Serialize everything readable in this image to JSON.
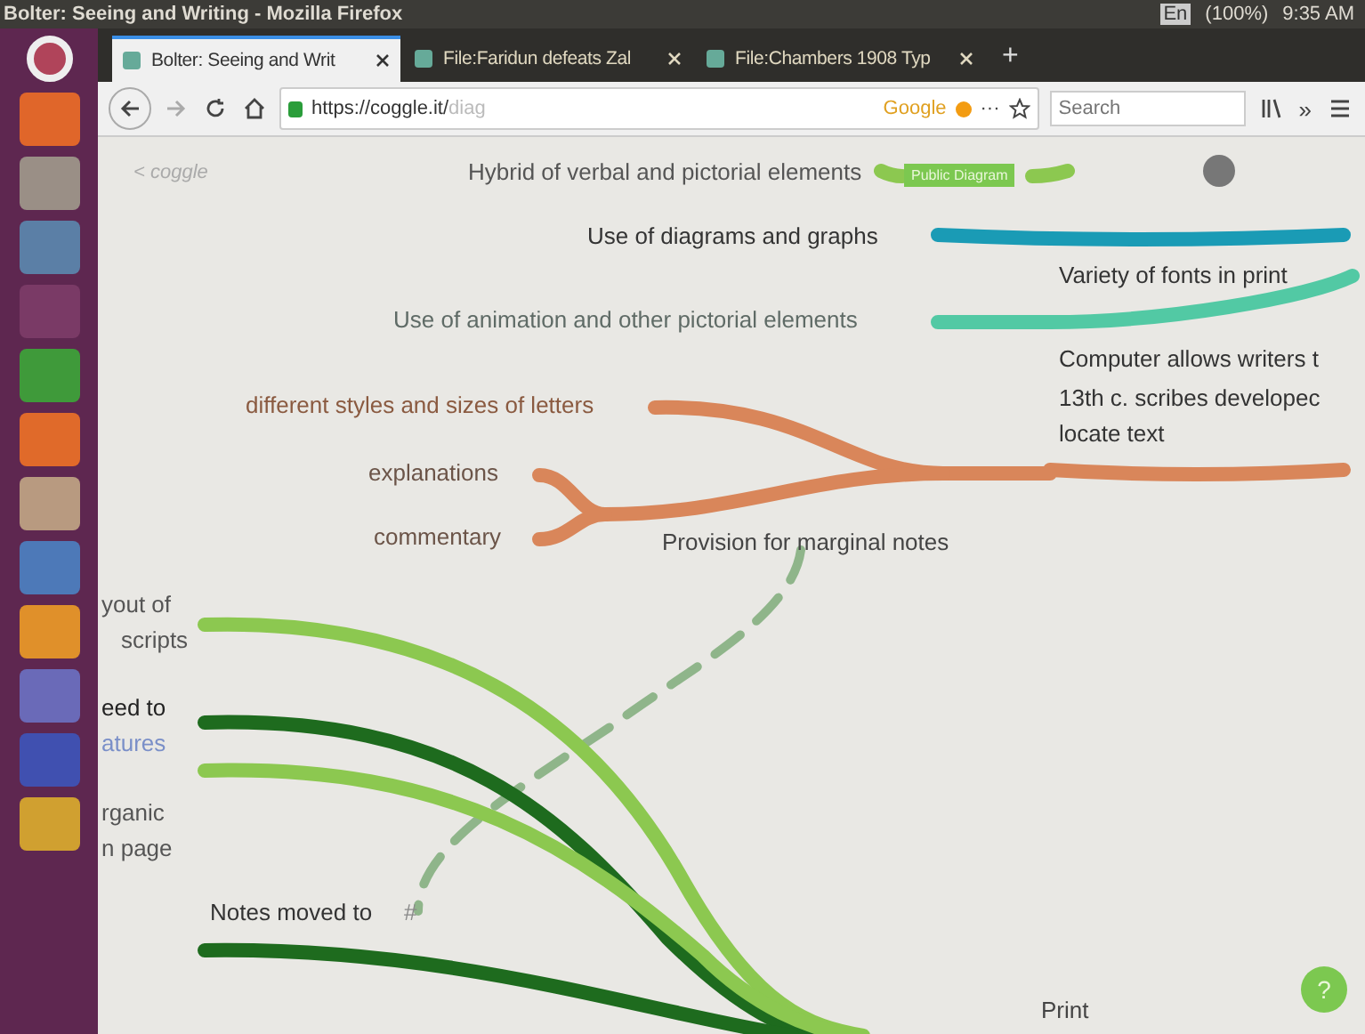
{
  "top_panel": {
    "title": "Bolter: Seeing and Writing - Mozilla Firefox",
    "keyboard": "En",
    "battery": "(100%)",
    "clock": "9:35 AM"
  },
  "tabs": [
    {
      "label": "Bolter: Seeing and Writ",
      "selected": true
    },
    {
      "label": "File:Faridun defeats Zal",
      "selected": false
    },
    {
      "label": "File:Chambers 1908 Typ",
      "selected": false
    }
  ],
  "new_tab": "+",
  "address_bar": {
    "url_host": "https://coggle.it/",
    "url_path": "diag",
    "search_engine": "Google"
  },
  "more": "···",
  "overflow": "»",
  "search": {
    "placeholder": "Search"
  },
  "coggle": {
    "back": "< coggle",
    "badge": "Public Diagram",
    "help": "?"
  },
  "nodes": [
    {
      "text": "Hybrid of verbal and pictorial elements",
      "color": "#555555"
    },
    {
      "text": "Use of diagrams and graphs",
      "color": "#333333"
    },
    {
      "text": "Variety of fonts in print",
      "color": "#333333"
    },
    {
      "text": "Use of animation and other pictorial elements",
      "color": "#5f6b66"
    },
    {
      "text": "Computer allows writers t",
      "color": "#333333"
    },
    {
      "text": "13th c. scribes developec",
      "color": "#333333"
    },
    {
      "text": "locate text",
      "color": "#333333"
    },
    {
      "text": "different styles and sizes of letters",
      "color": "#8a5a40"
    },
    {
      "text": "explanations",
      "color": "#6b5448"
    },
    {
      "text": "commentary",
      "color": "#6b5448"
    },
    {
      "text": "Provision for marginal notes",
      "color": "#444444"
    },
    {
      "text": "yout of",
      "color": "#555555"
    },
    {
      "text": "scripts",
      "color": "#555555"
    },
    {
      "text": "eed to",
      "color": "#222222"
    },
    {
      "text": "atures",
      "color": "#7a8fc8"
    },
    {
      "text": "rganic",
      "color": "#555555"
    },
    {
      "text": "n page",
      "color": "#555555"
    },
    {
      "text": "Notes moved to",
      "color": "#333333"
    },
    {
      "text": "#",
      "color": "#8a8a8a"
    },
    {
      "text": "Print",
      "color": "#444444"
    }
  ],
  "branches": [
    {
      "color": "#8cc850"
    },
    {
      "color": "#1a9bb5"
    },
    {
      "color": "#52c9a4"
    },
    {
      "color": "#d9865a"
    },
    {
      "color": "#d9865a"
    },
    {
      "color": "#d9865a"
    },
    {
      "color": "#d9865a"
    },
    {
      "color": "#d9865a"
    },
    {
      "color": "#8fb58a"
    },
    {
      "color": "#8cc850"
    },
    {
      "color": "#1e6b1e"
    },
    {
      "color": "#8cc850"
    },
    {
      "color": "#1e6b1e"
    }
  ]
}
